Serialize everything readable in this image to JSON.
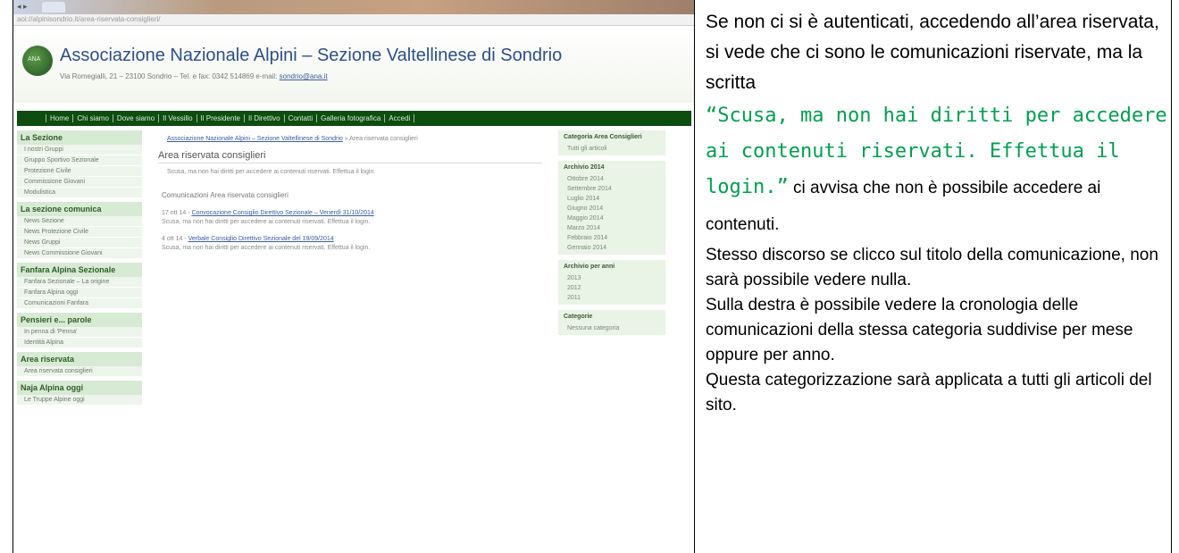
{
  "browser": {
    "tab_label": "◂ ▸",
    "address": "aoi://alpinisondrio.it/area-riservata-consiglieri/"
  },
  "site": {
    "title": "Associazione Nazionale Alpini – Sezione Valtellinese di Sondrio",
    "logo_text": "ANA",
    "address_line": "Via Romegialli, 21 – 23100 Sondrio – Tel. e fax: 0342 514869 e-mail: ",
    "email": "sondrio@ana.it"
  },
  "nav": [
    "Home",
    "Chi siamo",
    "Dove siamo",
    "Il Vessillo",
    "Il Presidente",
    "Il Direttivo",
    "Contatti",
    "Galleria fotografica",
    "Accedi"
  ],
  "sidebar": [
    {
      "title": "La Sezione",
      "items": [
        "I nostri Gruppi",
        "Gruppo Sportivo Sezionale",
        "Protezione Civile",
        "Commissione Giovani",
        "Modulistica"
      ]
    },
    {
      "title": "La sezione comunica",
      "items": [
        "News Sezione",
        "News Protezione Civile",
        "News Gruppi",
        "News Commissione Giovani"
      ]
    },
    {
      "title": "Fanfara Alpina Sezionale",
      "items": [
        "Fanfara Sezionale – La origine",
        "Fanfara Alpina oggi",
        "Comunicazioni Fanfara"
      ]
    },
    {
      "title": "Pensieri e... parole",
      "items": [
        "In penna di 'Penna'",
        "Identità Alpina"
      ]
    },
    {
      "title": "Area riservata",
      "items": [
        "Area riservata consiglieri"
      ]
    },
    {
      "title": "Naja Alpina oggi",
      "items": [
        "Le Truppe Alpine oggi"
      ]
    }
  ],
  "main": {
    "breadcrumb_link": "Associazione Nazionale Alpini – Sezione Valtellinese di Sondrio",
    "breadcrumb_tail": " » Area riservata consiglieri",
    "area_title": "Area riservata consiglieri",
    "denied": "Scusa, ma non hai diritti per accedere ai contenuti riservati. Effettua il login.",
    "comm_title": "Comunicazioni Area riservata consiglieri",
    "entries": [
      {
        "date": "17 ott 14 - ",
        "link": "Convocazione Consiglio Direttivo Sezionale – Venerdì 31/10/2014",
        "sub": "Scusa, ma non hai diritti per accedere ai contenuti riservati. Effettua il login."
      },
      {
        "date": "4 ott 14 - ",
        "link": "Verbale Consiglio Direttivo Sezionale del 19/09/2014",
        "sub": "Scusa, ma non hai diritti per accedere ai contenuti riservati. Effettua il login."
      }
    ]
  },
  "right": [
    {
      "title": "Categoria Area Consiglieri",
      "items": [
        "Tutti gli articoli"
      ]
    },
    {
      "title": "Archivio 2014",
      "items": [
        "Ottobre 2014",
        "Settembre 2014",
        "Luglio 2014",
        "Giugno 2014",
        "Maggio 2014",
        "Marzo 2014",
        "Febbraio 2014",
        "Gennaio 2014"
      ]
    },
    {
      "title": "Archivio per anni",
      "items": [
        "2013",
        "2012",
        "2011"
      ]
    },
    {
      "title": "Categorie",
      "items": [
        "Nessuna categoria"
      ]
    }
  ],
  "text": {
    "p1": "Se non ci si è autenticati, accedendo all’area riservata, si vede che ci sono le comunicazioni riservate, ma la scritta",
    "open_quote": "“",
    "quote": "Scusa, ma non hai diritti per accedere ai contenuti riservati. Effettua il login.",
    "close_quote": "”",
    "p1_tail": " ci avvisa che non è possibile accedere ai contenuti.",
    "p2": "Stesso discorso se clicco sul titolo della comunicazione, non sarà possibile vedere nulla.",
    "p3": "Sulla destra è possibile vedere la cronologia delle comunicazioni della stessa categoria suddivise per mese oppure per anno.",
    "p4": "Questa categorizzazione sarà applicata a tutti gli articoli del sito."
  },
  "colors": {
    "accent_green": "#00a050",
    "nav_green": "#0d4d10",
    "title_blue": "#2c4f8a"
  }
}
